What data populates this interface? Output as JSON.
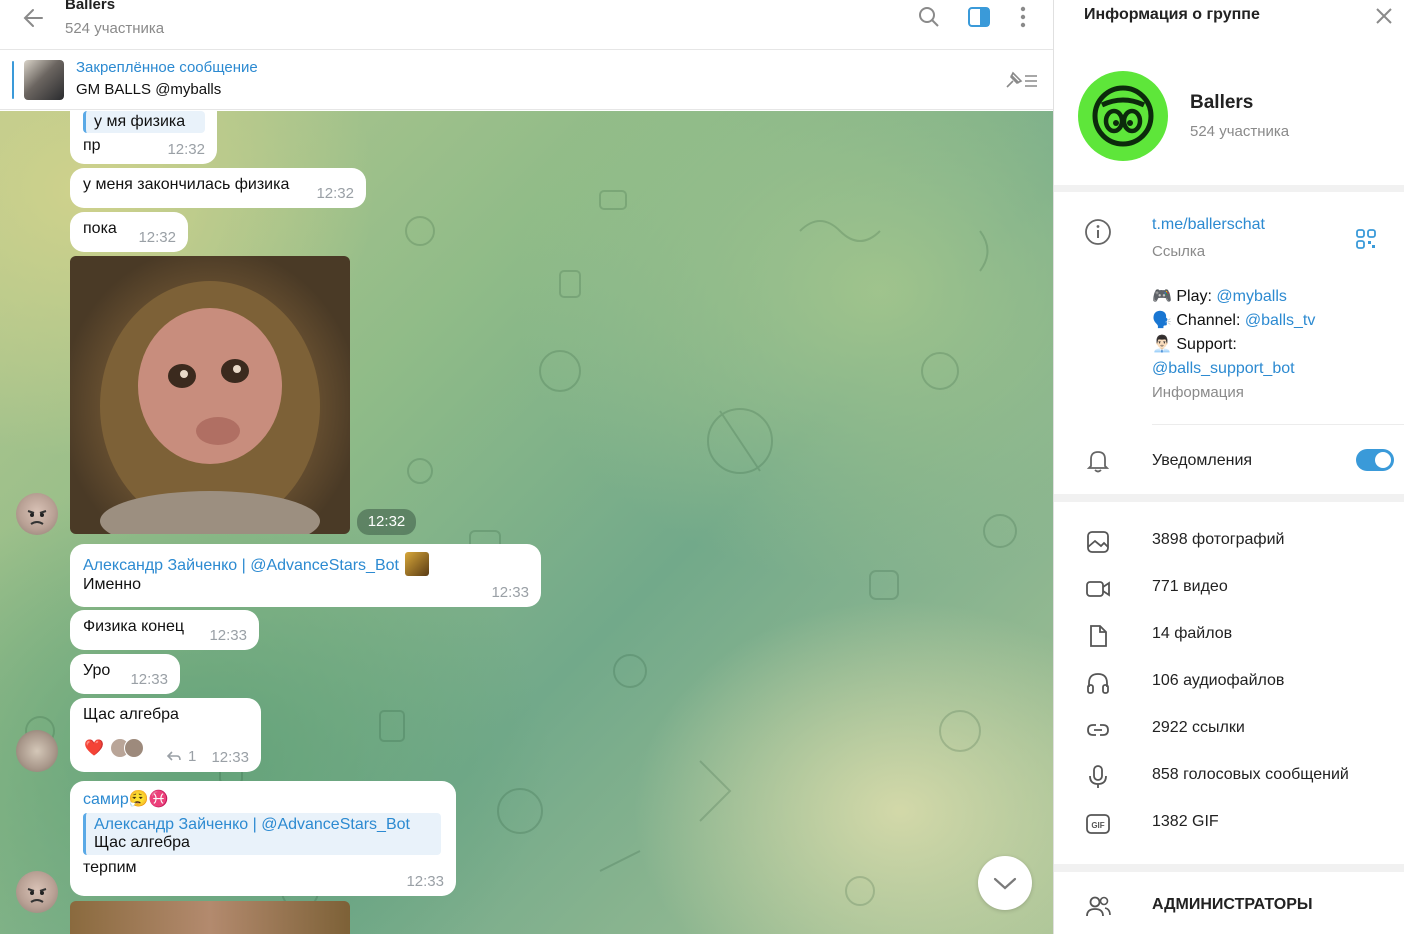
{
  "chat": {
    "title": "Ballers",
    "subtitle": "524 участника",
    "pinned": {
      "title": "Закреплённое сообщение",
      "text": "GM BALLS  @myballs"
    },
    "messages": [
      {
        "quote_text": "у мя физика",
        "text": "пр",
        "time": "12:32"
      },
      {
        "text": "у меня закончилась физика",
        "time": "12:32"
      },
      {
        "text": "пока",
        "time": "12:32"
      },
      {
        "photo_time": "12:32"
      },
      {
        "sender": "Александр Зайченко | @AdvanceStars_Bot",
        "text": "Именно",
        "time": "12:33"
      },
      {
        "text": "Физика конец",
        "time": "12:33"
      },
      {
        "text": "Уро",
        "time": "12:33"
      },
      {
        "text": "Щас алгебра",
        "reaction": "❤️",
        "reply_count": "1",
        "time": "12:33"
      },
      {
        "sender": "самир😮‍💨♓",
        "quote_name": "Александр Зайченко | @AdvanceStars_Bot",
        "quote_text": "Щас алгебра",
        "text": "терпим",
        "time": "12:33"
      }
    ]
  },
  "info": {
    "title": "Информация о группе",
    "group_name": "Ballers",
    "members": "524 участника",
    "link": "t.me/ballerschat",
    "link_caption": "Ссылка",
    "description": {
      "line1_prefix": "🎮 Play: ",
      "line1_link": "@myballs",
      "line2_prefix": "🗣️ Channel: ",
      "line2_link": "@balls_tv",
      "line3_prefix": "👨🏻‍💼 Support:",
      "line4_link": "@balls_support_bot"
    },
    "description_caption": "Информация",
    "notifications_label": "Уведомления",
    "notifications_on": true,
    "media": [
      {
        "icon": "photo-icon",
        "label": "3898 фотографий"
      },
      {
        "icon": "video-icon",
        "label": "771 видео"
      },
      {
        "icon": "file-icon",
        "label": "14 файлов"
      },
      {
        "icon": "headphones-icon",
        "label": "106 аудиофайлов"
      },
      {
        "icon": "link-icon",
        "label": "2922 ссылки"
      },
      {
        "icon": "microphone-icon",
        "label": "858 голосовых сообщений"
      },
      {
        "icon": "gif-icon",
        "label": "1382 GIF"
      }
    ],
    "admins_label": "АДМИНИСТРАТОРЫ"
  },
  "colors": {
    "accent": "#3a9ad9",
    "link": "#2c8ad1",
    "group_avatar": "#5ee63a"
  }
}
